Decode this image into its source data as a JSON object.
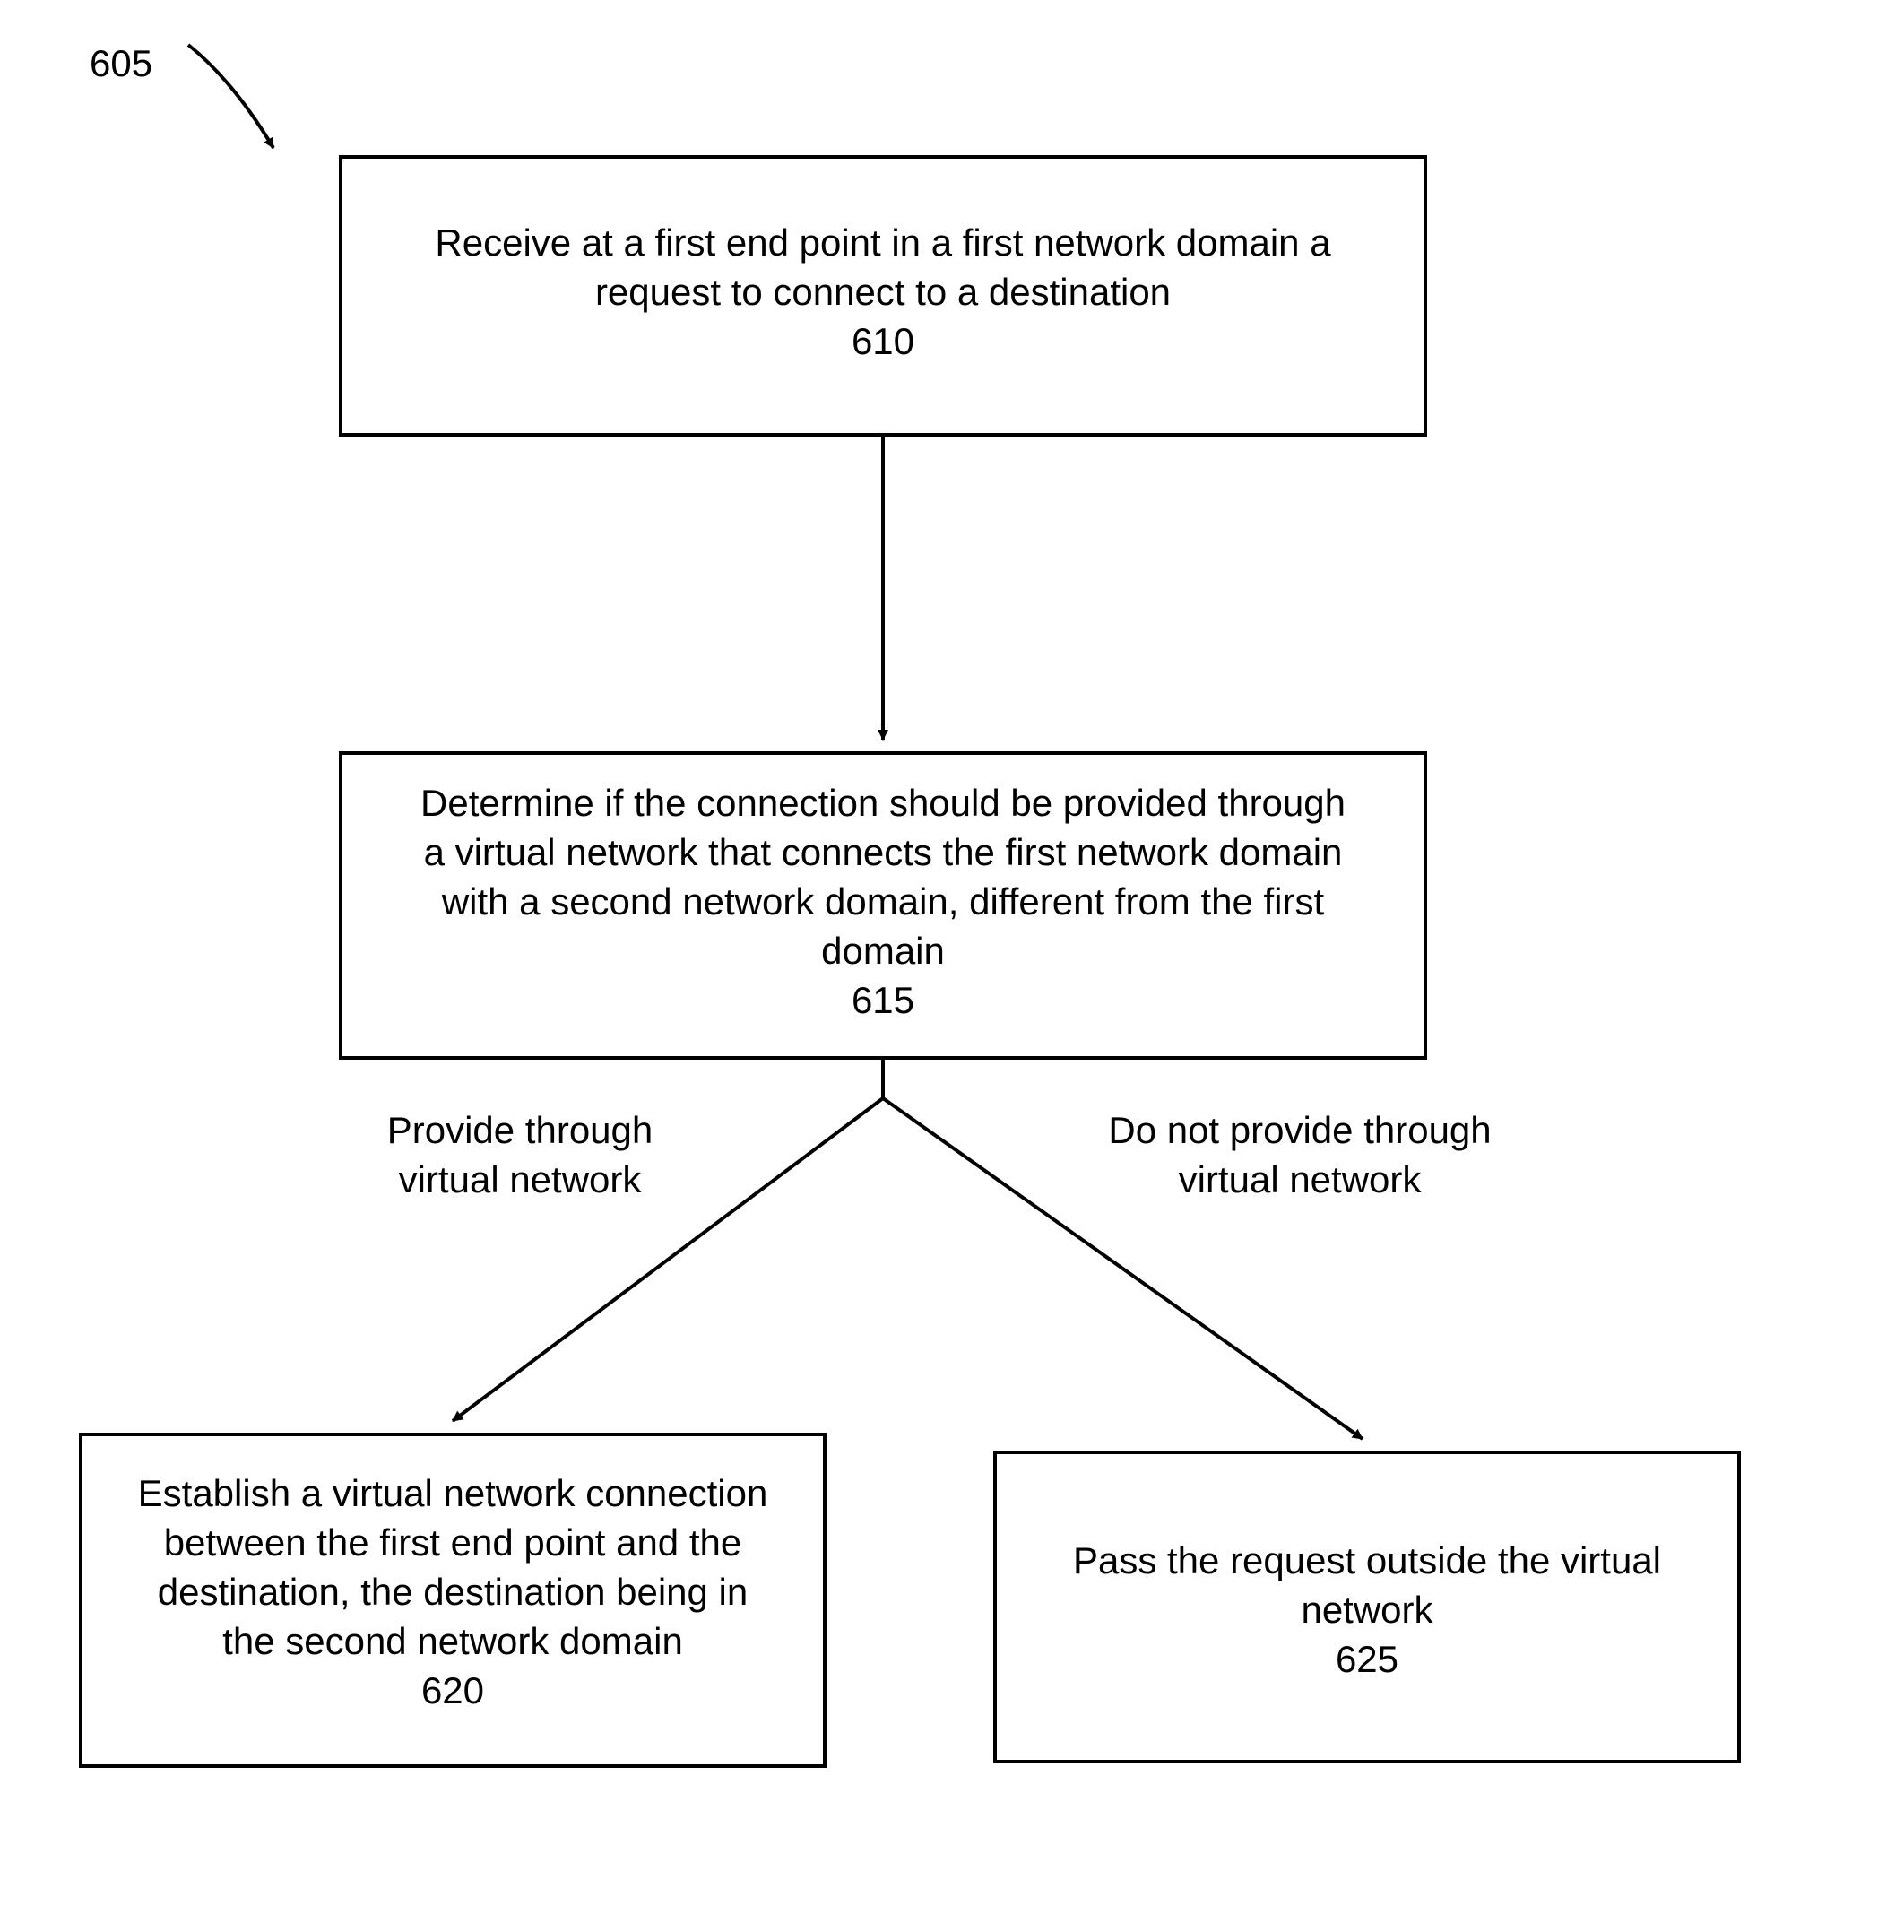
{
  "flow": {
    "ref_label": "605",
    "step1": {
      "line1": "Receive at a first end point in a first network domain a",
      "line2": "request to connect to a destination",
      "num": "610"
    },
    "step2": {
      "line1": "Determine if the connection should be provided through",
      "line2": "a virtual network that connects the first network domain",
      "line3": "with a second network domain, different from the first",
      "line4": "domain",
      "num": "615"
    },
    "branch_left": {
      "line1": "Provide through",
      "line2": "virtual network"
    },
    "branch_right": {
      "line1": "Do not provide through",
      "line2": "virtual network"
    },
    "step3": {
      "line1": "Establish a virtual network connection",
      "line2": "between the first end point and the",
      "line3": "destination, the destination being in",
      "line4": "the second network domain",
      "num": "620"
    },
    "step4": {
      "line1": "Pass the request outside the virtual",
      "line2": "network",
      "num": "625"
    }
  }
}
